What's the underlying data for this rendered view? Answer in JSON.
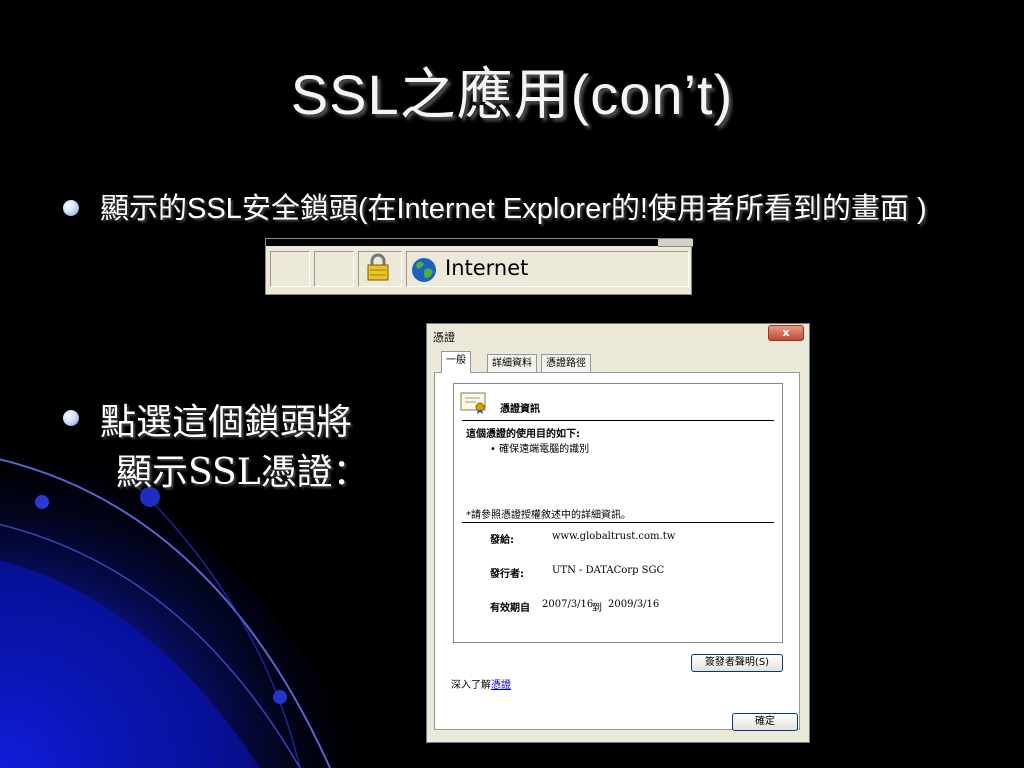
{
  "slide": {
    "title": "SSL之應用(con’t)",
    "bullet1": "顯示的SSL安全鎖頭(在Internet Explorer的!使用者所看到的畫面 )",
    "bullet2_line1": "點選這個鎖頭將",
    "bullet2_line2": "顯示SSL憑證："
  },
  "ie_status_bar": {
    "zone_label": "Internet",
    "icons": [
      "lock-icon",
      "globe-icon"
    ]
  },
  "cert_dialog": {
    "title": "憑證",
    "close_label": "x",
    "tabs": [
      "一般",
      "詳細資料",
      "憑證路徑"
    ],
    "active_tab": "一般",
    "info_heading": "憑證資訊",
    "purpose_heading": "這個憑證的使用目的如下:",
    "purpose_item": "• 確保遠端電腦的識別",
    "note": "*請參照憑證授權敘述中的詳細資訊。",
    "issued_to_label": "發給:",
    "issued_to_value": "www.globaltrust.com.tw",
    "issuer_label": "發行者:",
    "issuer_value": "UTN - DATACorp SGC",
    "validity_label": "有效期自",
    "valid_from": "2007/3/16",
    "to_word": "到",
    "valid_to": "2009/3/16",
    "issuer_statement_button": "簽發者聲明(S)",
    "learn_more_prefix": "深入了解",
    "learn_more_link": "憑證",
    "ok_button": "確定",
    "icons": [
      "certificate-icon"
    ]
  },
  "colors": {
    "background": "#000000",
    "accent_blue": "#0a14c8",
    "dialog_face": "#ece9d8"
  }
}
